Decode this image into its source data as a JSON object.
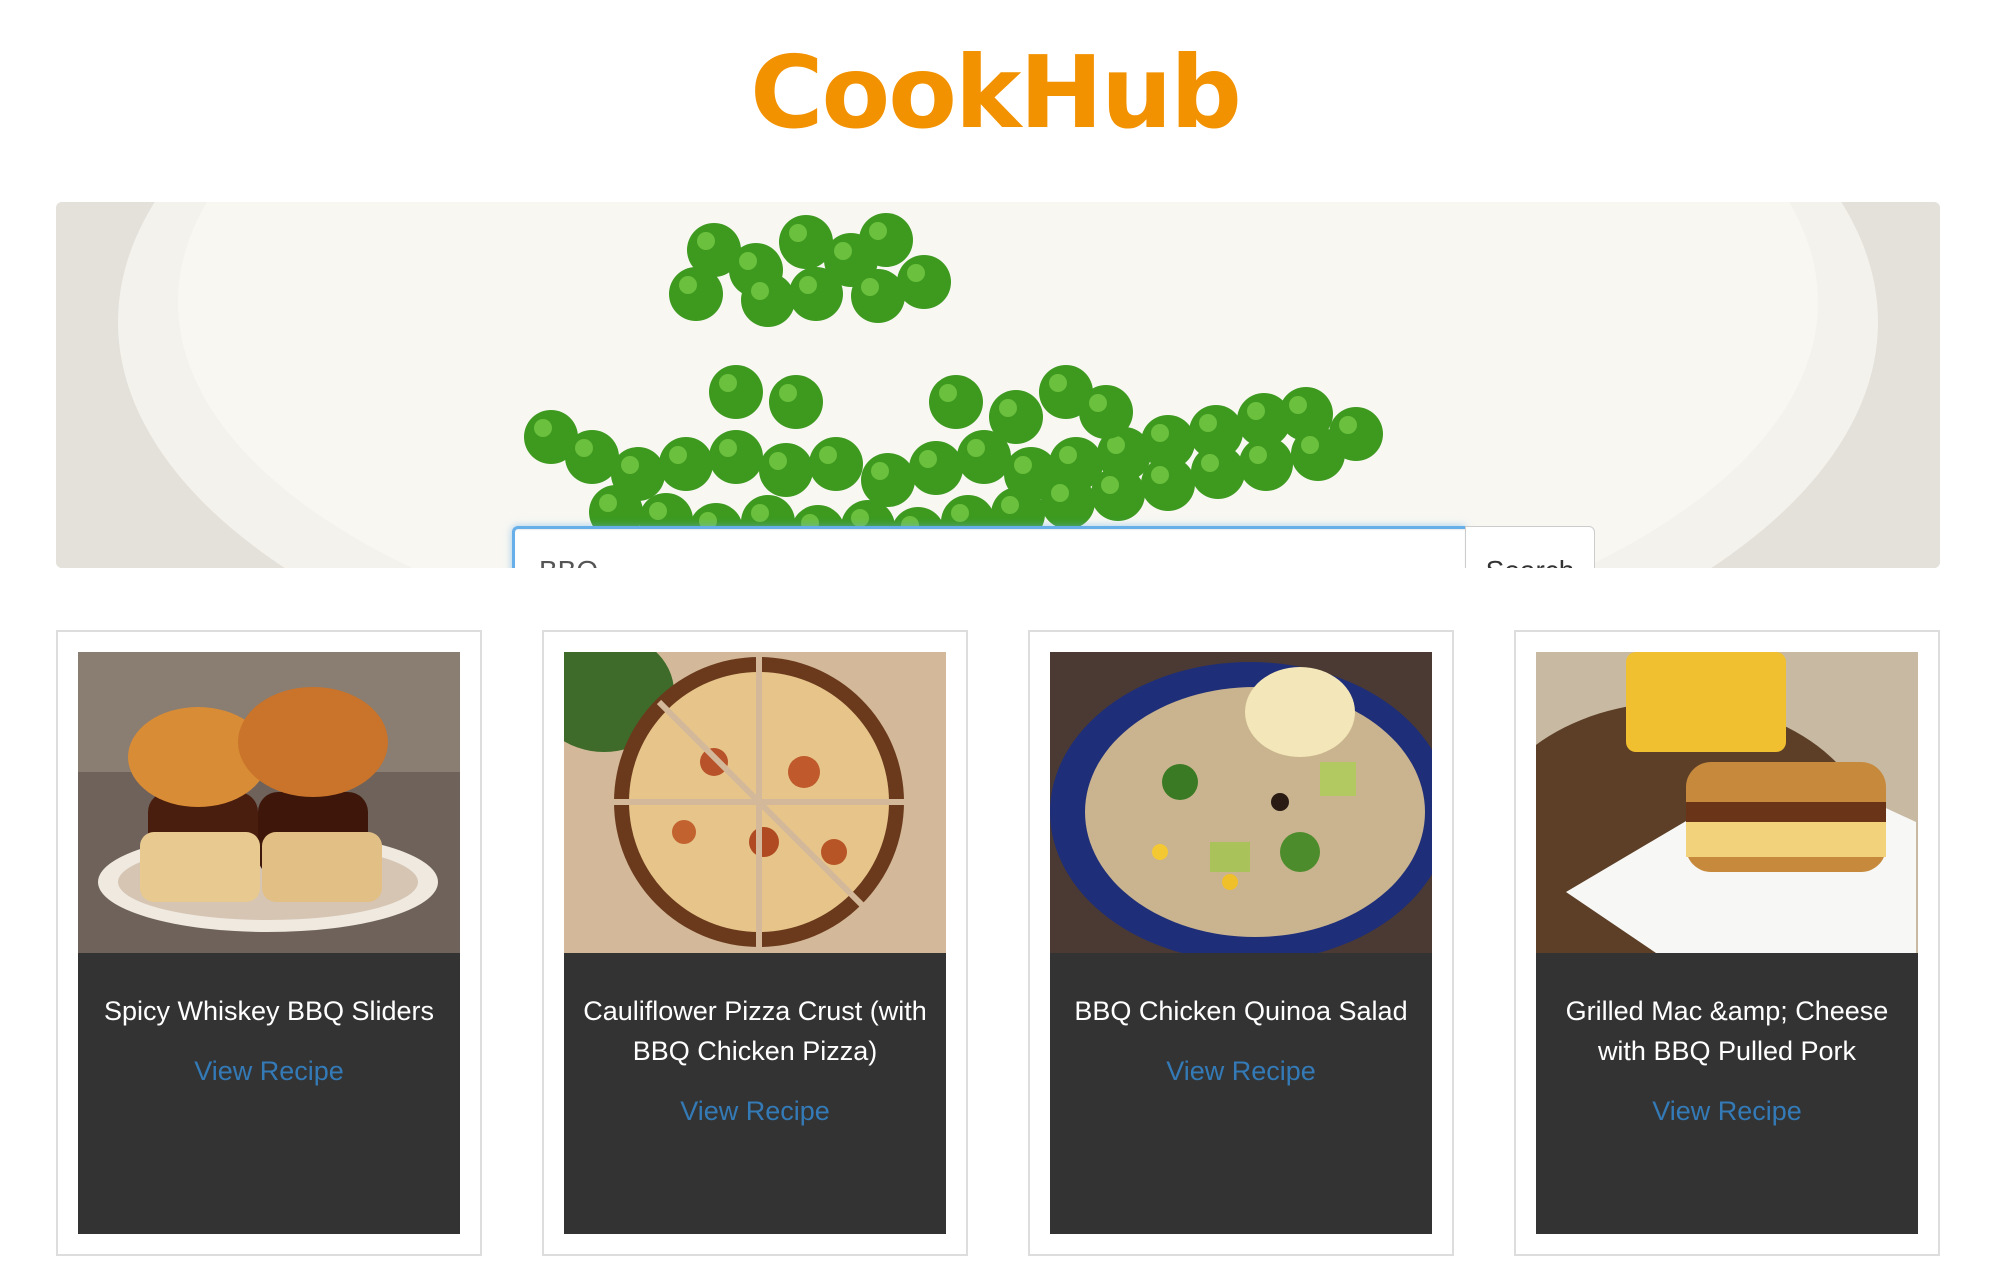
{
  "header": {
    "logo": "CookHub"
  },
  "search": {
    "value": "BBQ",
    "button_label": "Search"
  },
  "hero": {
    "image": "green peas on a white plate"
  },
  "colors": {
    "brand": "#f39200",
    "link": "#337ab7",
    "card_body": "#333333",
    "focus": "#66afe9"
  },
  "recipes": [
    {
      "title": "Spicy Whiskey BBQ Sliders",
      "link": "View Recipe",
      "image": "bbq sliders on a plate"
    },
    {
      "title": "Cauliflower Pizza Crust (with BBQ Chicken Pizza)",
      "link": "View Recipe",
      "image": "sliced bbq chicken pizza"
    },
    {
      "title": "BBQ Chicken Quinoa Salad",
      "link": "View Recipe",
      "image": "quinoa salad in a blue bowl"
    },
    {
      "title": "Grilled Mac &amp; Cheese with BBQ Pulled Pork",
      "link": "View Recipe",
      "image": "grilled sandwich on a white plate"
    }
  ]
}
